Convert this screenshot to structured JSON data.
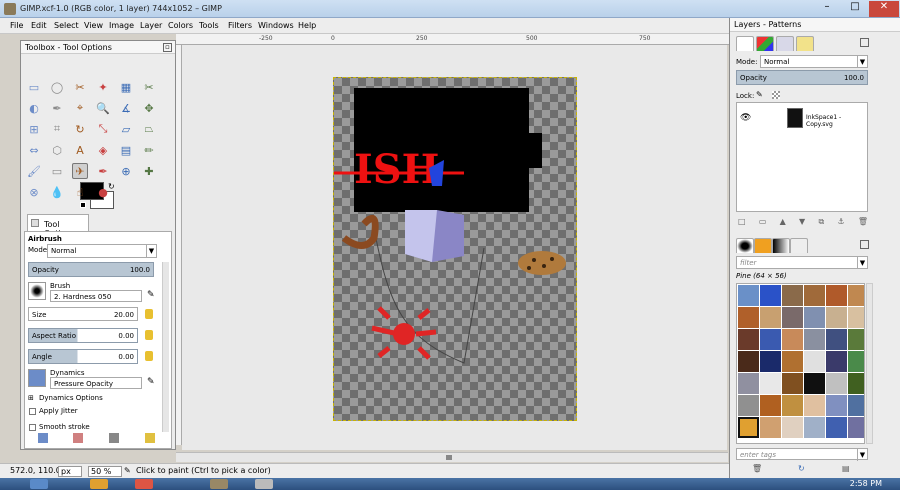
{
  "window": {
    "title": "GIMP.xcf-1.0 (RGB color, 1 layer) 744x1052 – GIMP",
    "controls": [
      "–",
      "□",
      "✕"
    ]
  },
  "menubar": [
    "File",
    "Edit",
    "Select",
    "View",
    "Image",
    "Layer",
    "Colors",
    "Tools",
    "Filters",
    "Windows",
    "Help"
  ],
  "rulers": {
    "top_labels": [
      "-250",
      "0",
      "250",
      "500",
      "750"
    ]
  },
  "toolbox": {
    "title": "Toolbox - Tool Options",
    "tools": [
      "rect-select-icon",
      "ellipse-select-icon",
      "free-select-icon",
      "fuzzy-select-icon",
      "by-color-select-icon",
      "scissors-select-icon",
      "foreground-select-icon",
      "paths-icon",
      "color-picker-icon",
      "zoom-icon",
      "measure-icon",
      "move-icon",
      "align-icon",
      "crop-icon",
      "rotate-icon",
      "scale-icon",
      "shear-icon",
      "perspective-icon",
      "flip-icon",
      "cage-icon",
      "text-icon",
      "bucket-fill-icon",
      "blend-icon",
      "pencil-icon",
      "paintbrush-icon",
      "eraser-icon",
      "airbrush-icon",
      "ink-icon",
      "clone-icon",
      "heal-icon",
      "perspective-clone-icon",
      "blur-icon",
      "smudge-icon",
      "dodge-burn-icon"
    ],
    "options_tab": "Tool Options",
    "tool_name": "Airbrush",
    "mode_label": "Mode:",
    "mode_value": "Normal",
    "opacity_label": "Opacity",
    "opacity_value": "100.0",
    "brush_label": "Brush",
    "brush_value": "2. Hardness 050",
    "size_label": "Size",
    "size_value": "20.00",
    "aspect_label": "Aspect Ratio",
    "aspect_value": "0.00",
    "angle_label": "Angle",
    "angle_value": "0.00",
    "dynamics_label": "Dynamics",
    "dynamics_value": "Pressure Opacity",
    "dynamics_options": "Dynamics Options",
    "apply_jitter": "Apply Jitter",
    "smooth_stroke": "Smooth stroke"
  },
  "canvas": {
    "text_art": "ISH"
  },
  "statusbar": {
    "coords": "572.0, 110.0",
    "unit": "px",
    "zoom": "50 %",
    "message": "Click to paint (Ctrl to pick a color)"
  },
  "taskbar": {
    "clock": "2:58 PM"
  },
  "dock": {
    "title": "Layers - Patterns",
    "mode_label": "Mode:",
    "mode_value": "Normal",
    "opacity_label": "Opacity",
    "opacity_value": "100.0",
    "lock_label": "Lock:",
    "layer_name": "InkSpace1 - Copy.svg",
    "filter_placeholder": "filter",
    "pattern_info": "Pine (64 × 56)",
    "tags_placeholder": "enter tags"
  },
  "colors": {
    "fg": "#000000",
    "bg": "#ffffff",
    "selection_bar": "#b8c6d3"
  }
}
